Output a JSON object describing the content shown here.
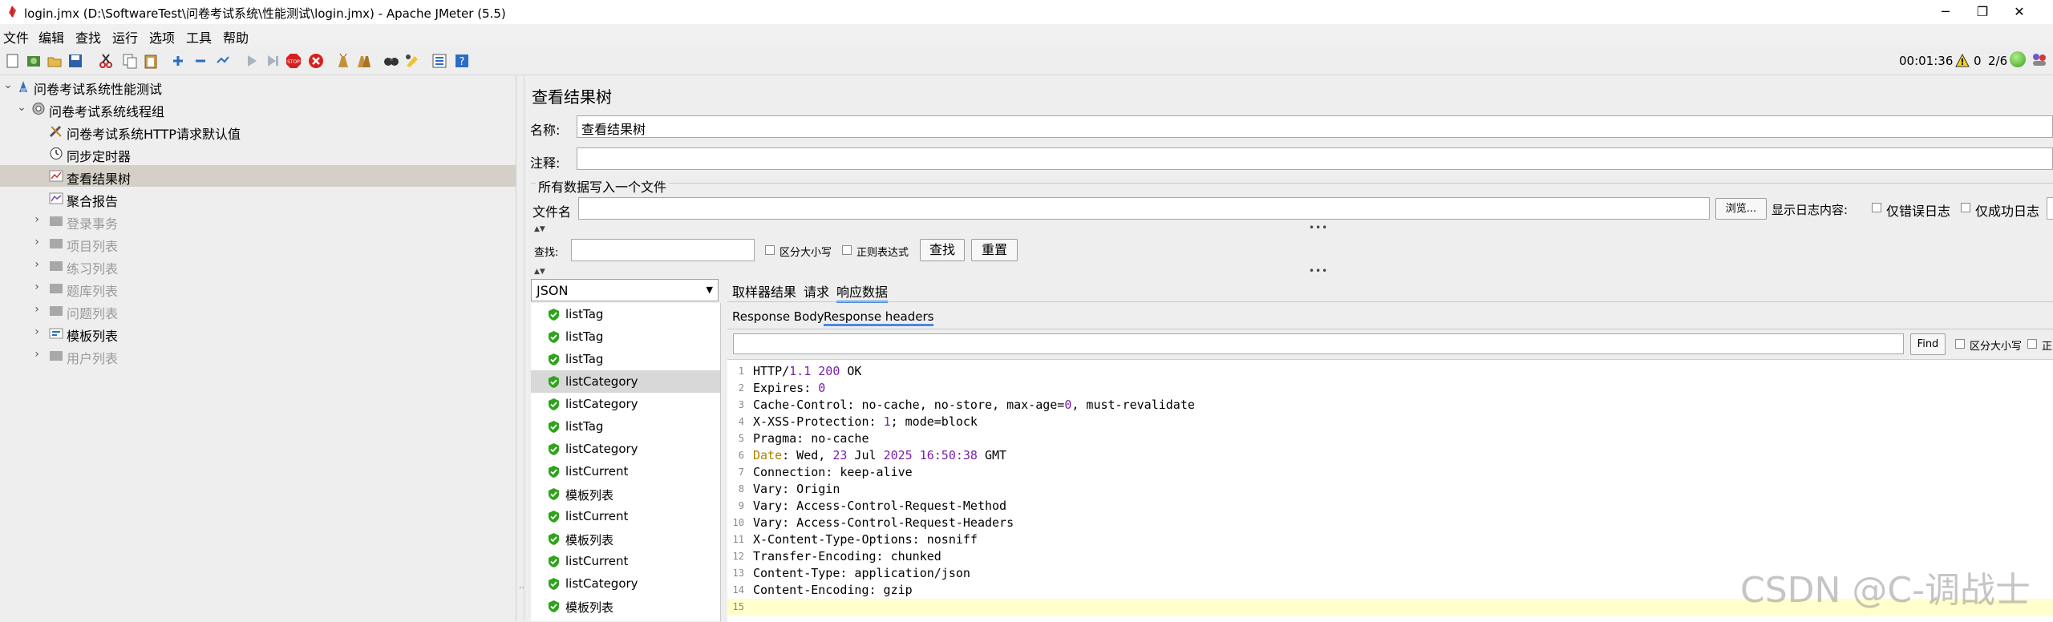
{
  "window": {
    "title": "login.jmx (D:\\SoftwareTest\\问卷考试系统\\性能测试\\login.jmx) - Apache JMeter (5.5)",
    "minimize": "─",
    "maximize": "❐",
    "close": "✕"
  },
  "menu": [
    "文件",
    "编辑",
    "查找",
    "运行",
    "选项",
    "工具",
    "帮助"
  ],
  "status": {
    "elapsed": "00:01:36",
    "warnings": "0",
    "threads": "2/6"
  },
  "tree": [
    {
      "label": "问卷考试系统性能测试",
      "icon": "test-plan-icon",
      "toggle": "⌄",
      "enabled": true,
      "selected": false
    },
    {
      "label": "问卷考试系统线程组",
      "icon": "thread-group-icon",
      "toggle": "⌄",
      "enabled": true,
      "selected": false
    },
    {
      "label": "问卷考试系统HTTP请求默认值",
      "icon": "wrench-icon",
      "toggle": "",
      "enabled": true,
      "selected": false
    },
    {
      "label": "同步定时器",
      "icon": "timer-icon",
      "toggle": "",
      "enabled": true,
      "selected": false
    },
    {
      "label": "查看结果树",
      "icon": "listener-icon",
      "toggle": "",
      "enabled": true,
      "selected": true
    },
    {
      "label": "聚合报告",
      "icon": "report-icon",
      "toggle": "",
      "enabled": true,
      "selected": false
    },
    {
      "label": "登录事务",
      "icon": "controller-icon",
      "toggle": "›",
      "enabled": false,
      "selected": false
    },
    {
      "label": "项目列表",
      "icon": "controller-icon",
      "toggle": "›",
      "enabled": false,
      "selected": false
    },
    {
      "label": "练习列表",
      "icon": "controller-icon",
      "toggle": "›",
      "enabled": false,
      "selected": false
    },
    {
      "label": "题库列表",
      "icon": "controller-icon",
      "toggle": "›",
      "enabled": false,
      "selected": false
    },
    {
      "label": "问题列表",
      "icon": "controller-icon",
      "toggle": "›",
      "enabled": false,
      "selected": false
    },
    {
      "label": "模板列表",
      "icon": "transaction-icon",
      "toggle": "›",
      "enabled": true,
      "selected": false
    },
    {
      "label": "用户列表",
      "icon": "controller-icon",
      "toggle": "›",
      "enabled": false,
      "selected": false
    }
  ],
  "panel": {
    "title": "查看结果树",
    "name_label": "名称:",
    "name_value": "查看结果树",
    "comment_label": "注释:",
    "comment_value": "",
    "file_section": "所有数据写入一个文件",
    "file_label": "文件名",
    "file_value": "",
    "browse": "浏览...",
    "log_label": "显示日志内容:",
    "errors_only": "仅错误日志",
    "success_only": "仅成功日志"
  },
  "search": {
    "label": "查找:",
    "value": "",
    "case_sensitive": "区分大小写",
    "regex": "正则表达式",
    "find_button": "查找",
    "reset_button": "重置"
  },
  "renderer": {
    "selected": "JSON"
  },
  "results": [
    {
      "label": "listTag",
      "selected": false
    },
    {
      "label": "listTag",
      "selected": false
    },
    {
      "label": "listTag",
      "selected": false
    },
    {
      "label": "listCategory",
      "selected": true
    },
    {
      "label": "listCategory",
      "selected": false
    },
    {
      "label": "listTag",
      "selected": false
    },
    {
      "label": "listCategory",
      "selected": false
    },
    {
      "label": "listCurrent",
      "selected": false
    },
    {
      "label": "模板列表",
      "selected": false
    },
    {
      "label": "listCurrent",
      "selected": false
    },
    {
      "label": "模板列表",
      "selected": false
    },
    {
      "label": "listCurrent",
      "selected": false
    },
    {
      "label": "listCategory",
      "selected": false
    },
    {
      "label": "模板列表",
      "selected": false
    }
  ],
  "tabs": [
    "取样器结果",
    "请求",
    "响应数据"
  ],
  "active_tab": "响应数据",
  "subtabs": [
    "Response Body",
    "Response headers"
  ],
  "active_subtab": "Response headers",
  "response_search": {
    "value": "",
    "find_button": "Find",
    "case_sensitive": "区分大小写",
    "regex_partial": "正"
  },
  "headers": [
    {
      "num": "1",
      "parts": [
        [
          "HTTP/",
          ""
        ],
        [
          "1.1",
          "c-proto"
        ],
        [
          " ",
          ""
        ],
        [
          "200",
          "c-num"
        ],
        [
          " OK",
          ""
        ]
      ]
    },
    {
      "num": "2",
      "parts": [
        [
          "Expires: ",
          ""
        ],
        [
          "0",
          "c-num"
        ]
      ]
    },
    {
      "num": "3",
      "parts": [
        [
          "Cache-Control: no-cache, no-store, max-age=",
          ""
        ],
        [
          "0",
          "c-num"
        ],
        [
          ", must-revalidate",
          ""
        ]
      ]
    },
    {
      "num": "4",
      "parts": [
        [
          "X-XSS-Protection: ",
          ""
        ],
        [
          "1",
          "c-num"
        ],
        [
          "; mode=block",
          ""
        ]
      ]
    },
    {
      "num": "5",
      "parts": [
        [
          "Pragma: no-cache",
          ""
        ]
      ]
    },
    {
      "num": "6",
      "parts": [
        [
          "Date",
          "c-date"
        ],
        [
          ": Wed, ",
          ""
        ],
        [
          "23",
          "c-num"
        ],
        [
          " Jul ",
          ""
        ],
        [
          "2025",
          "c-num"
        ],
        [
          " ",
          ""
        ],
        [
          "16:50:38",
          "c-num"
        ],
        [
          " GMT",
          ""
        ]
      ]
    },
    {
      "num": "7",
      "parts": [
        [
          "Connection: keep-alive",
          ""
        ]
      ]
    },
    {
      "num": "8",
      "parts": [
        [
          "Vary: Origin",
          ""
        ]
      ]
    },
    {
      "num": "9",
      "parts": [
        [
          "Vary: Access-Control-Request-Method",
          ""
        ]
      ]
    },
    {
      "num": "10",
      "parts": [
        [
          "Vary: Access-Control-Request-Headers",
          ""
        ]
      ]
    },
    {
      "num": "11",
      "parts": [
        [
          "X-Content-Type-Options: nosniff",
          ""
        ]
      ]
    },
    {
      "num": "12",
      "parts": [
        [
          "Transfer-Encoding: chunked",
          ""
        ]
      ]
    },
    {
      "num": "13",
      "parts": [
        [
          "Content-Type: application/json",
          ""
        ]
      ]
    },
    {
      "num": "14",
      "parts": [
        [
          "Content-Encoding: gzip",
          ""
        ]
      ]
    },
    {
      "num": "15",
      "parts": [
        [
          "",
          ""
        ]
      ]
    }
  ],
  "current_line": "15",
  "watermark": "CSDN @C-调战士",
  "colors": {
    "selection": "#d4d0c8",
    "tab_accent": "#4a8ae0",
    "success": "#2fa31b",
    "current_line": "#ffffcc"
  }
}
